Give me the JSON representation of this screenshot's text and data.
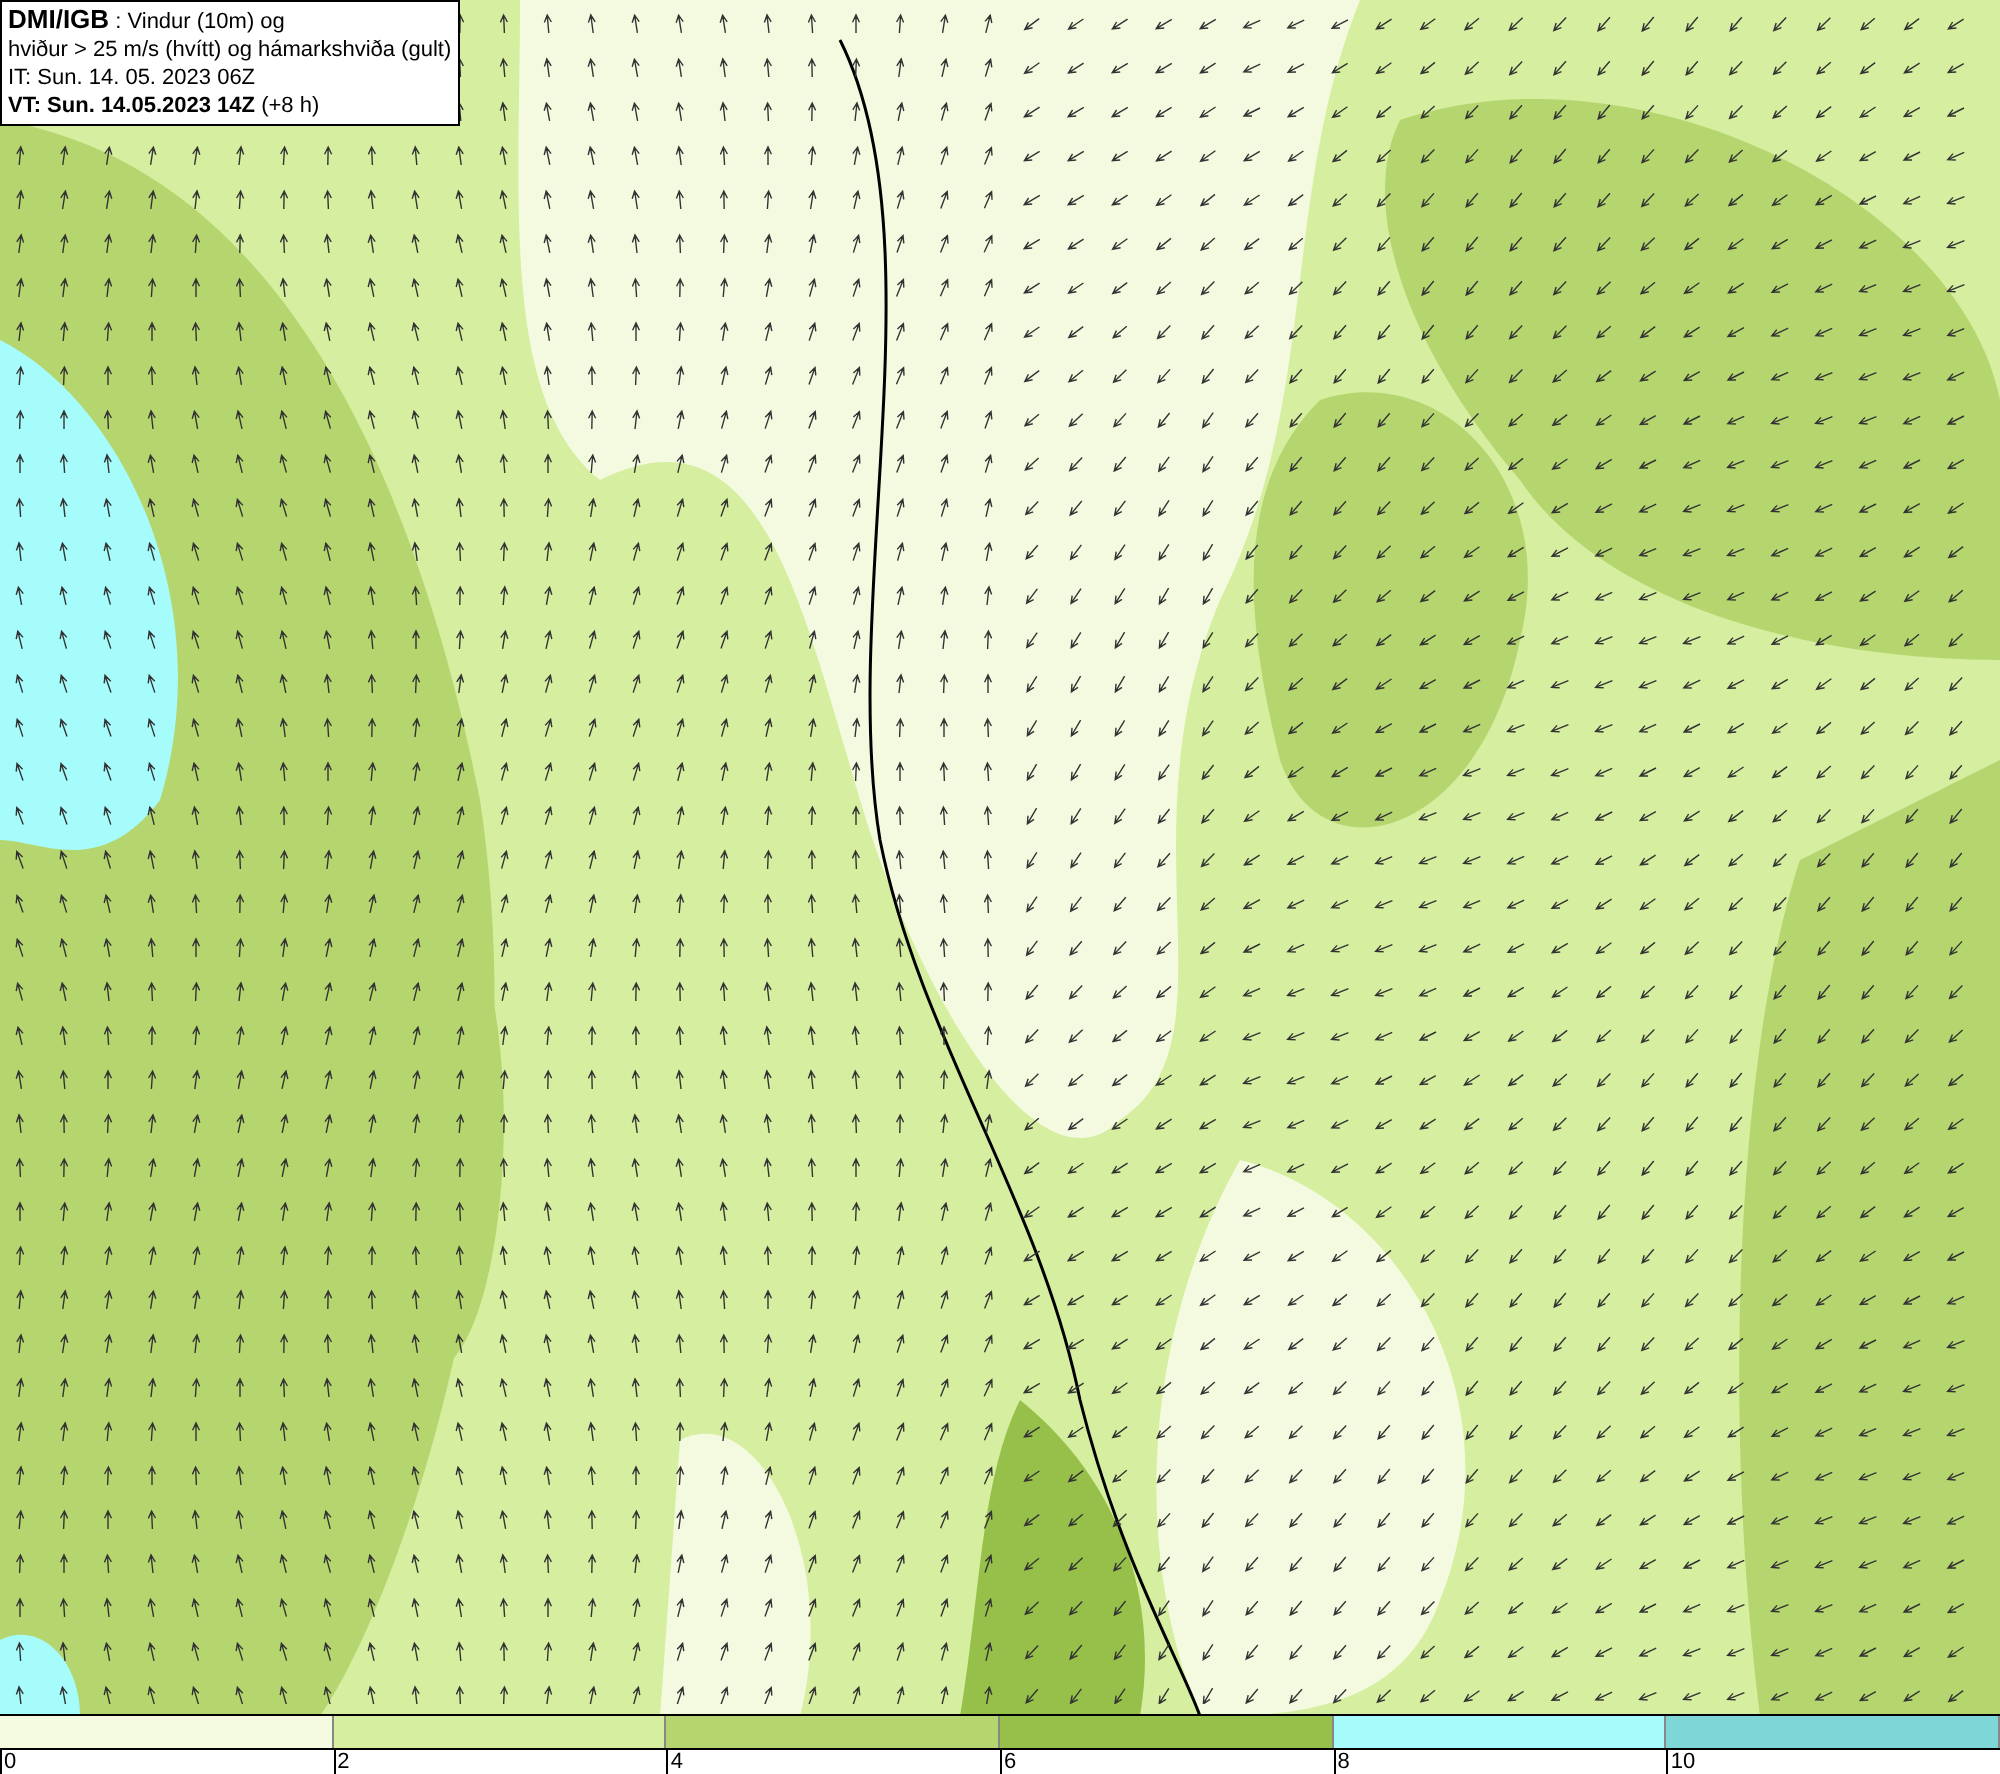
{
  "header": {
    "source": "DMI/IGB",
    "title": " : Vindur (10m) og",
    "subtitle": "hviður > 25 m/s (hvítt) og hámarkshviða (gult)",
    "issue_time": "IT: Sun. 14. 05. 2023 06Z",
    "valid_time": "VT: Sun. 14.05.2023 14Z",
    "offset": "(+8 h)"
  },
  "legend": {
    "bins": [
      {
        "color": "#f4fadf"
      },
      {
        "color": "#d5ee9f"
      },
      {
        "color": "#b5d66f"
      },
      {
        "color": "#96c04a"
      },
      {
        "color": "#a6fbfb"
      },
      {
        "color": "#7fd6d6"
      }
    ],
    "ticks": [
      "0",
      "2",
      "4",
      "6",
      "8",
      "10"
    ]
  }
}
